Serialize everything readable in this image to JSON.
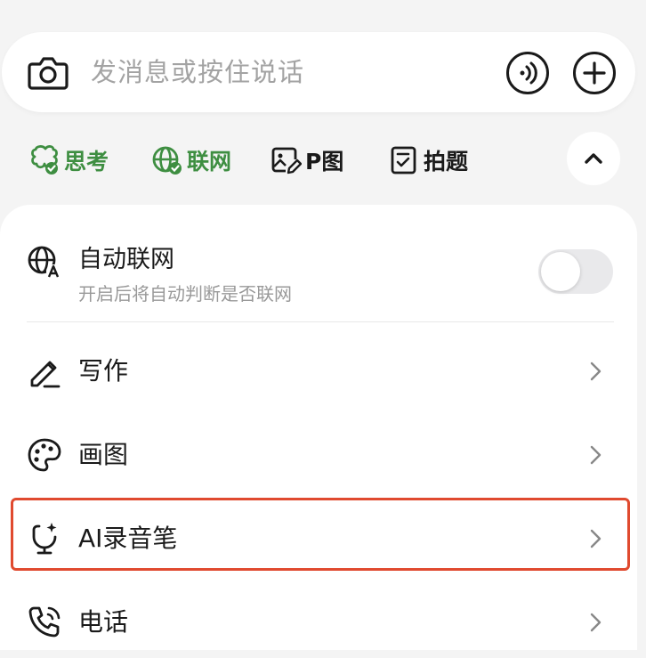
{
  "input": {
    "placeholder": "发消息或按住说话"
  },
  "chips": [
    {
      "label": "思考",
      "icon": "think-icon",
      "active": true
    },
    {
      "label": "联网",
      "icon": "globe-check-icon",
      "active": true
    },
    {
      "label": "P图",
      "icon": "image-edit-icon",
      "active": false
    },
    {
      "label": "拍题",
      "icon": "question-scan-icon",
      "active": false
    }
  ],
  "panel": {
    "auto_web": {
      "title": "自动联网",
      "subtitle": "开启后将自动判断是否联网",
      "enabled": false
    },
    "items": [
      {
        "label": "写作",
        "icon": "pen-icon"
      },
      {
        "label": "画图",
        "icon": "palette-icon"
      },
      {
        "label": "AI录音笔",
        "icon": "recorder-icon"
      },
      {
        "label": "电话",
        "icon": "phone-icon"
      }
    ]
  },
  "colors": {
    "accent_green": "#3e8e41",
    "highlight_red": "#e04a2f",
    "background": "#f4f4f4"
  }
}
